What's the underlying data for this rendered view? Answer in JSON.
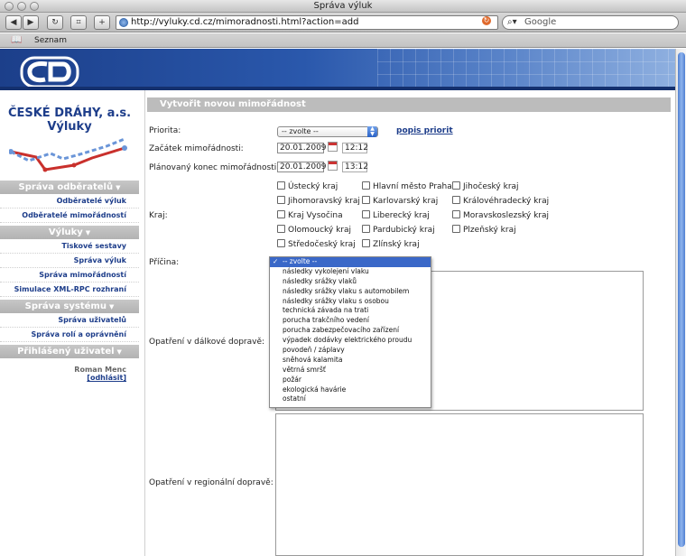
{
  "browser": {
    "window_title": "Správa výluk",
    "back_icon": "back-arrow-icon",
    "forward_icon": "forward-arrow-icon",
    "url": "http://vyluky.cd.cz/mimoradnosti.html?action=add",
    "search_placeholder": "Google",
    "bookmark_label": "Seznam"
  },
  "sidebar": {
    "company_line1": "ČESKÉ DRÁHY, a.s.",
    "company_line2": "Výluky",
    "sections": [
      {
        "title": "Správa odběratelů",
        "items": [
          "Odběratelé výluk",
          "Odběratelé mimořádností"
        ]
      },
      {
        "title": "Výluky",
        "items": [
          "Tiskové sestavy",
          "Správa výluk",
          "Správa mimořádností",
          "Simulace XML-RPC rozhraní"
        ]
      },
      {
        "title": "Správa systému",
        "items": [
          "Správa uživatelů",
          "Správa rolí a oprávnění"
        ]
      },
      {
        "title": "Přihlášený uživatel",
        "items": []
      }
    ],
    "user_name": "Roman Menc",
    "logout": "[odhlásit]"
  },
  "form": {
    "title": "Vytvořit novou mimořádnost",
    "priority_label": "Priorita:",
    "priority_value": "-- zvolte --",
    "priority_link": "popis priorit",
    "start_label": "Začátek mimořádnosti:",
    "start_date": "20.01.2009",
    "start_time": "12:12",
    "end_label": "Plánovaný konec mimořádnosti:",
    "end_date": "20.01.2009",
    "end_time": "13:12",
    "region_label": "Kraj:",
    "regions": [
      [
        "Ústecký kraj",
        "Hlavní město Praha",
        "Jihočeský kraj"
      ],
      [
        "Jihomoravský kraj",
        "Karlovarský kraj",
        "Královéhradecký kraj"
      ],
      [
        "Kraj Vysočina",
        "Liberecký kraj",
        "Moravskoslezský kraj"
      ],
      [
        "Olomoucký kraj",
        "Pardubický kraj",
        "Plzeňský kraj"
      ],
      [
        "Středočeský kraj",
        "Zlínský kraj"
      ]
    ],
    "cause_label": "Příčina:",
    "cause_options": [
      "-- zvolte --",
      "následky vykolejení vlaku",
      "následky srážky vlaků",
      "následky srážky vlaku s automobilem",
      "následky srážky vlaku s osobou",
      "technická závada na trati",
      "porucha trakčního vedení",
      "porucha zabezpečovacího zařízení",
      "výpadek dodávky elektrického proudu",
      "povodeň / záplavy",
      "sněhová kalamita",
      "větrná smršť",
      "požár",
      "ekologická havárie",
      "ostatní"
    ],
    "cause_selected_index": 0,
    "long_distance_label": "Opatření v dálkové dopravě:",
    "regional_label": "Opatření v regionální dopravě:"
  }
}
